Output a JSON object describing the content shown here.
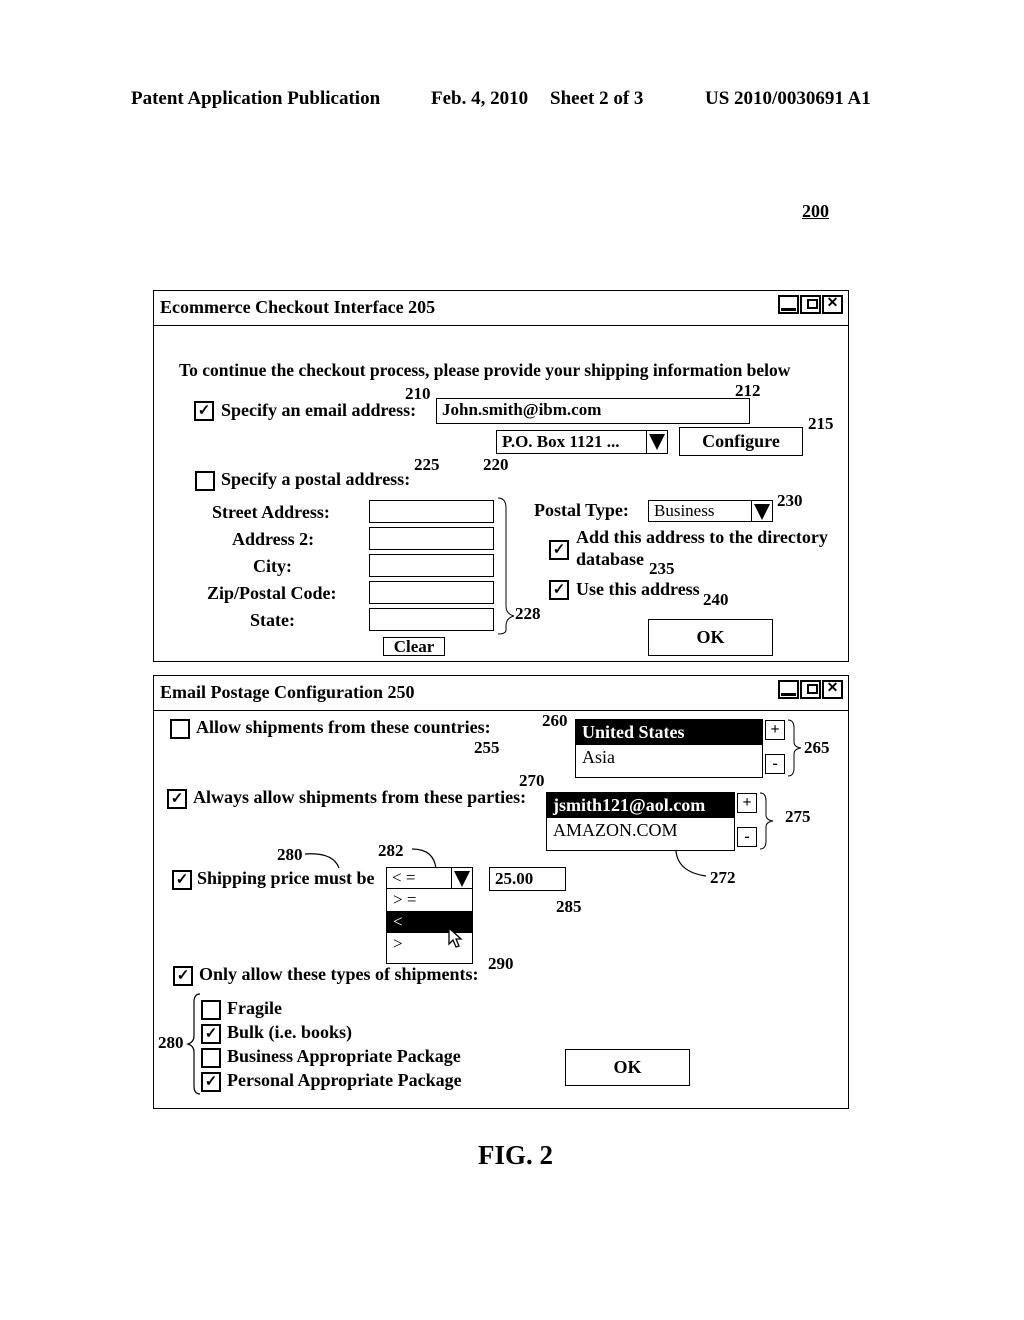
{
  "header": {
    "publication": "Patent Application Publication",
    "date": "Feb. 4, 2010",
    "sheet": "Sheet 2 of 3",
    "number": "US 2010/0030691 A1"
  },
  "figure_ref": "200",
  "figure_caption": "FIG. 2",
  "checkout_window": {
    "title": "Ecommerce Checkout Interface 205",
    "instruction": "To continue the checkout process, please provide your shipping information below",
    "email": {
      "label": "Specify an email address:",
      "checked": true,
      "value": "John.smith@ibm.com"
    },
    "address_dropdown": {
      "value": "P.O. Box 1121 ..."
    },
    "configure_label": "Configure",
    "postal": {
      "label": "Specify a postal address:",
      "checked": false,
      "fields": [
        {
          "label": "Street Address:",
          "value": ""
        },
        {
          "label": "Address 2:",
          "value": ""
        },
        {
          "label": "City:",
          "value": ""
        },
        {
          "label": "Zip/Postal Code:",
          "value": ""
        },
        {
          "label": "State:",
          "value": ""
        }
      ],
      "clear_label": "Clear"
    },
    "postal_type": {
      "label": "Postal Type:",
      "value": "Business"
    },
    "add_to_directory": {
      "label_line1": "Add this address to the directory",
      "label_line2": "database",
      "checked": true
    },
    "use_address": {
      "label": "Use this address",
      "checked": true
    },
    "ok_label": "OK",
    "refs": {
      "r210": "210",
      "r212": "212",
      "r215": "215",
      "r225": "225",
      "r220": "220",
      "r228": "228",
      "r230": "230",
      "r235": "235",
      "r240": "240"
    }
  },
  "postage_window": {
    "title": "Email Postage Configuration 250",
    "countries": {
      "label": "Allow shipments from these countries:",
      "checked": false,
      "items": [
        {
          "text": "United States",
          "selected": true
        },
        {
          "text": "Asia",
          "selected": false
        }
      ]
    },
    "parties": {
      "label": "Always allow shipments from these parties:",
      "checked": true,
      "items": [
        {
          "text": "jsmith121@aol.com",
          "selected": true
        },
        {
          "text": "AMAZON.COM",
          "selected": false
        }
      ]
    },
    "add_label": "+",
    "remove_label": "-",
    "shipping_price": {
      "label": "Shipping price must be",
      "checked": true,
      "operator": "< =",
      "options": [
        {
          "text": "> =",
          "selected": false
        },
        {
          "text": "<",
          "selected": true
        },
        {
          "text": ">",
          "selected": false
        }
      ],
      "amount": "25.00"
    },
    "shipment_types": {
      "label": "Only allow these types of shipments:",
      "checked": true,
      "items": [
        {
          "text": "Fragile",
          "checked": false
        },
        {
          "text": "Bulk (i.e. books)",
          "checked": true
        },
        {
          "text": "Business Appropriate Package",
          "checked": false
        },
        {
          "text": "Personal Appropriate Package",
          "checked": true
        }
      ]
    },
    "ok_label": "OK",
    "refs": {
      "r255": "255",
      "r260": "260",
      "r265": "265",
      "r270": "270",
      "r275": "275",
      "r272": "272",
      "r280a": "280",
      "r282": "282",
      "r285": "285",
      "r290": "290",
      "r280b": "280"
    }
  }
}
